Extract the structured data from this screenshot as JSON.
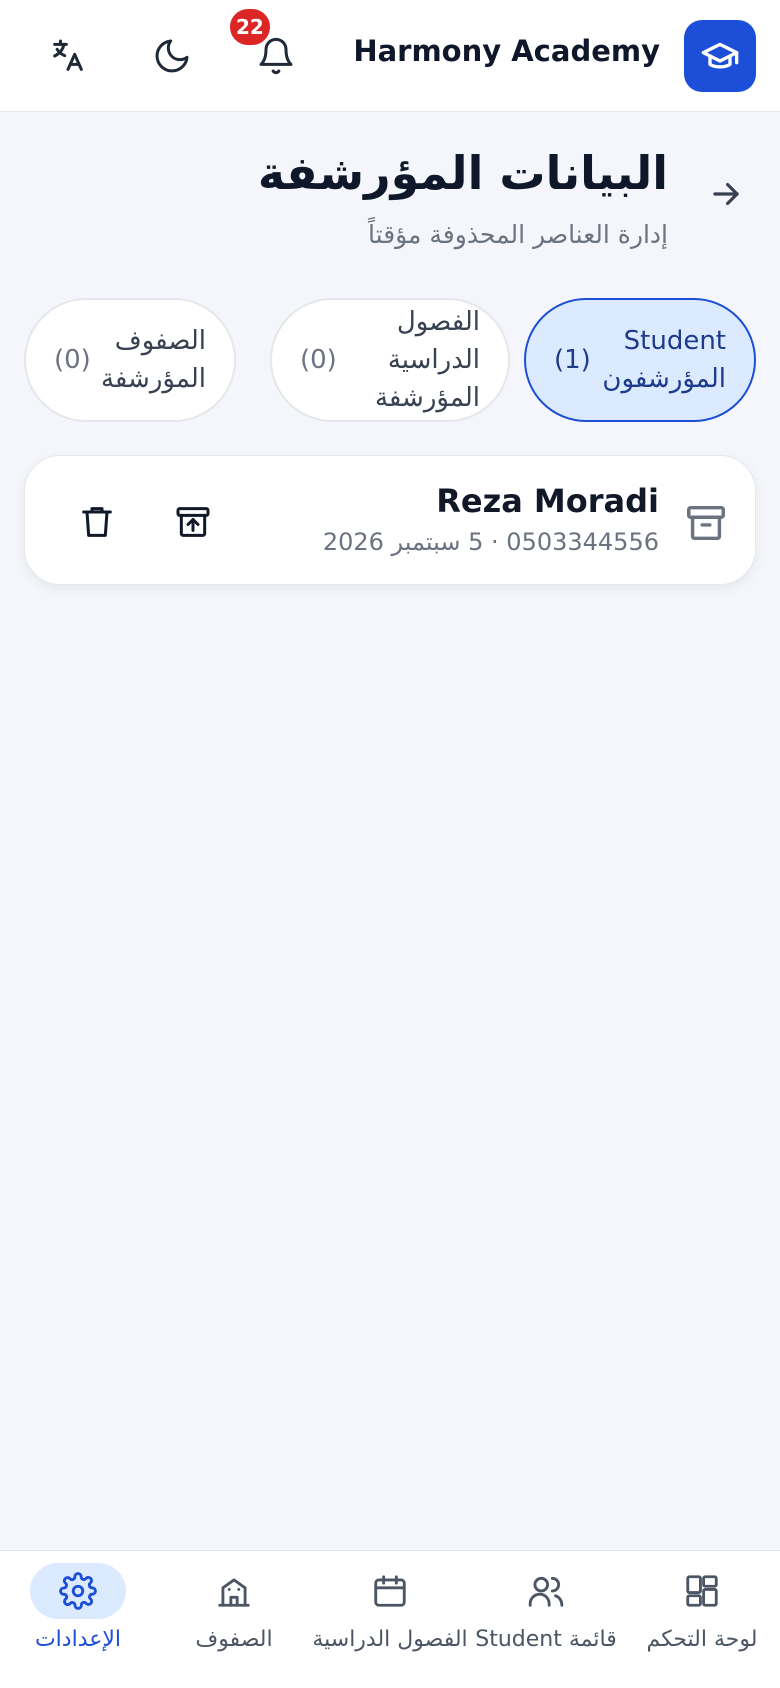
{
  "colors": {
    "brand": "#1d4ed8",
    "badge": "#dc2626",
    "active_tab_bg": "#dbeafe",
    "text_muted": "#6b7280"
  },
  "header": {
    "app_name": "Harmony Academy",
    "logo_icon": "graduation-cap-icon",
    "notifications_count": "22",
    "icons": [
      "bell-icon",
      "moon-icon",
      "translate-icon"
    ]
  },
  "page": {
    "title": "البيانات المؤرشفة",
    "subtitle": "إدارة العناصر المحذوفة مؤقتاً",
    "back_icon": "arrow-right-icon"
  },
  "tabs": [
    {
      "label": "Student المؤرشفون",
      "count": "(1)",
      "active": true
    },
    {
      "label": "الفصول الدراسية المؤرشفة",
      "count": "(0)",
      "active": false
    },
    {
      "label": "الصفوف المؤرشفة",
      "count": "(0)",
      "active": false
    }
  ],
  "records": [
    {
      "name": "Reza Moradi",
      "meta": "0503344556 · 5 سبتمبر 2026",
      "icon": "archive-box-icon",
      "actions": [
        "restore-icon",
        "trash-icon"
      ]
    }
  ],
  "bottom_nav": [
    {
      "label": "لوحة التحكم",
      "icon": "dashboard-icon",
      "active": false
    },
    {
      "label": "قائمة Student",
      "icon": "users-icon",
      "active": false
    },
    {
      "label": "الفصول الدراسية",
      "icon": "calendar-icon",
      "active": false
    },
    {
      "label": "الصفوف",
      "icon": "school-building-icon",
      "active": false
    },
    {
      "label": "الإعدادات",
      "icon": "gear-icon",
      "active": true
    }
  ]
}
